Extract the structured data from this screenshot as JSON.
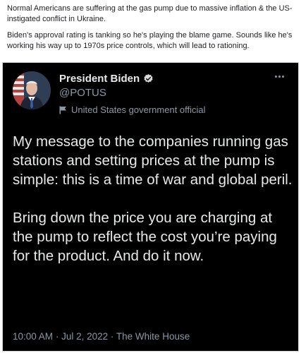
{
  "post": {
    "paragraphs": [
      "Normal Americans are suffering at the gas pump due to massive inflation & the US-instigated conflict in Ukraine.",
      "Biden's approval rating is tanking so he's playing the blame game. Sounds like he's working his way up to 1970s price controls, which will lead to rationing."
    ]
  },
  "tweet": {
    "display_name": "President Biden",
    "handle": "@POTUS",
    "account_label": "United States government official",
    "body_paragraphs": [
      "My message to the companies running gas stations and setting prices at the pump is simple: this is a time of war and global peril.",
      "Bring down the price you are charging at the pump to reflect the cost you’re paying for the product. And do it now."
    ],
    "time": "10:00 AM",
    "date": "Jul 2, 2022",
    "source": "The White House",
    "separator": "·",
    "avatar_icon": "profile-photo-icon",
    "verified_icon": "verified-badge-icon",
    "label_icon": "flag-icon",
    "more_icon": "more-options-icon"
  }
}
